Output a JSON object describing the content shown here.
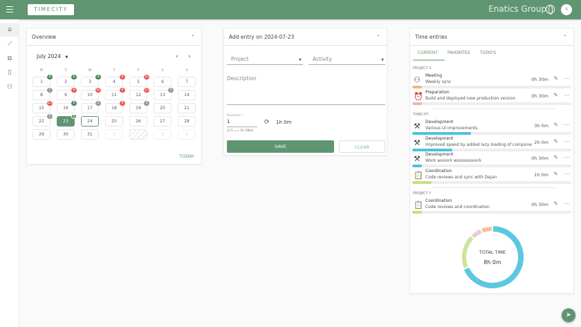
{
  "header": {
    "logo": "TIMECITY",
    "org": "Enatics Group",
    "avatar": "S"
  },
  "overview": {
    "title": "Overview",
    "month": "July 2024",
    "today": "TODAY",
    "weekdays": [
      "M",
      "T",
      "W",
      "T",
      "F",
      "S",
      "S"
    ],
    "days": [
      {
        "n": "1",
        "b": "8",
        "c": "g"
      },
      {
        "n": "2",
        "b": "8",
        "c": "g"
      },
      {
        "n": "3",
        "b": "8",
        "c": "g"
      },
      {
        "n": "4",
        "b": "9",
        "c": "r"
      },
      {
        "n": "5",
        "b": "10",
        "c": "r"
      },
      {
        "n": "6"
      },
      {
        "n": "7"
      },
      {
        "n": "8",
        "b": "7",
        "c": "x"
      },
      {
        "n": "9",
        "b": "9",
        "c": "r"
      },
      {
        "n": "10",
        "b": "10",
        "c": "r"
      },
      {
        "n": "11",
        "b": "9",
        "c": "r"
      },
      {
        "n": "12",
        "b": "13",
        "c": "r"
      },
      {
        "n": "13",
        "b": "5",
        "c": "x"
      },
      {
        "n": "14"
      },
      {
        "n": "15",
        "b": "13",
        "c": "r"
      },
      {
        "n": "16",
        "b": "8",
        "c": "g"
      },
      {
        "n": "17",
        "b": "5",
        "c": "x"
      },
      {
        "n": "18",
        "b": "9",
        "c": "r"
      },
      {
        "n": "19",
        "b": "3",
        "c": "x"
      },
      {
        "n": "20"
      },
      {
        "n": "21"
      },
      {
        "n": "22",
        "b": "5",
        "c": "x"
      },
      {
        "n": "23",
        "b": "8",
        "c": "g",
        "sel": true
      },
      {
        "n": "24",
        "today": true
      },
      {
        "n": "25"
      },
      {
        "n": "26"
      },
      {
        "n": "27"
      },
      {
        "n": "28"
      },
      {
        "n": "29"
      },
      {
        "n": "30"
      },
      {
        "n": "31"
      },
      {
        "n": "1",
        "out": true
      },
      {
        "n": "",
        "hatch": true
      },
      {
        "n": "3",
        "out": true
      },
      {
        "n": "4",
        "out": true
      }
    ]
  },
  "entry": {
    "title": "Add entry on 2024-07-23",
    "project": "Project",
    "activity": "Activity",
    "description": "Description",
    "duration_label": "Duration *",
    "duration": "1",
    "duration_hint": "(1.5 == 1h 30m)",
    "duration_text": "1h 0m",
    "save": "SAVE",
    "clear": "CLEAR"
  },
  "time": {
    "title": "Time entries",
    "tabs": [
      "CURRENT",
      "FAVORITES",
      "TODO'S"
    ],
    "groups": [
      {
        "name": "PROJECT X",
        "entries": [
          {
            "title": "Meeting",
            "desc": "Weekly sync",
            "dur": "0h 30m",
            "icon": "meeting-icon",
            "color": "#f6b08a",
            "pct": 6
          },
          {
            "title": "Preparation",
            "desc": "Build and deployed new production version",
            "dur": "0h 30m",
            "icon": "alarm-clock-icon",
            "color": "#e6b8b8",
            "pct": 6
          }
        ]
      },
      {
        "name": "TIMECITY",
        "entries": [
          {
            "title": "Development",
            "desc": "Various UI improvements",
            "dur": "3h 0m",
            "icon": "tools-icon",
            "color": "#4cc3dc",
            "pct": 37
          },
          {
            "title": "Development",
            "desc": "Improved speed by added lazy loading of compone...",
            "dur": "2h 0m",
            "icon": "tools-icon",
            "color": "#4cc3dc",
            "pct": 25
          },
          {
            "title": "Development",
            "desc": "Work wooork woooooooork",
            "dur": "0h 30m",
            "icon": "tools-icon",
            "color": "#4cc3dc",
            "pct": 6
          },
          {
            "title": "Coordination",
            "desc": "Code reviews and sync with Dejan",
            "dur": "1h 0m",
            "icon": "clipboard-icon",
            "color": "#c5df7f",
            "pct": 12
          }
        ]
      },
      {
        "name": "PROJECT Y",
        "entries": [
          {
            "title": "Coordination",
            "desc": "Code reviews and coordination",
            "dur": "0h 30m",
            "icon": "clipboard-icon",
            "color": "#c5df7f",
            "pct": 6
          }
        ]
      }
    ],
    "total_label": "TOTAL TIME",
    "total": "8h 0m",
    "donut": [
      {
        "name": "Development",
        "hours": 5.5,
        "color": "#5cc8e0"
      },
      {
        "name": "Coordination",
        "hours": 1.5,
        "color": "#cfe39a"
      },
      {
        "name": "Preparation",
        "hours": 0.5,
        "color": "#e6cfcf"
      },
      {
        "name": "Meeting",
        "hours": 0.5,
        "color": "#f6c09c"
      }
    ]
  }
}
